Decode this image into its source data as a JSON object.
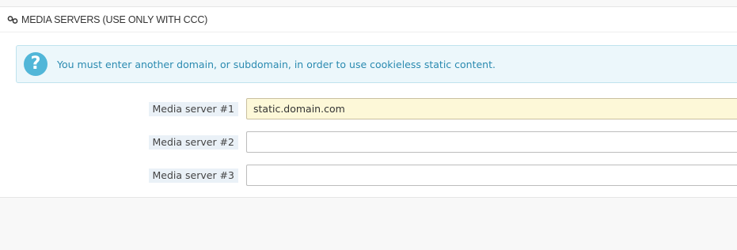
{
  "panel": {
    "title": "MEDIA SERVERS (USE ONLY WITH CCC)",
    "title_icon": "link-icon"
  },
  "alert": {
    "icon": "question-icon",
    "icon_glyph": "?",
    "message": "You must enter another domain, or subdomain, in order to use cookieless static content."
  },
  "fields": [
    {
      "label": "Media server #1",
      "value": "static.domain.com",
      "placeholder": ""
    },
    {
      "label": "Media server #2",
      "value": "",
      "placeholder": ""
    },
    {
      "label": "Media server #3",
      "value": "",
      "placeholder": ""
    }
  ],
  "colors": {
    "alert_bg": "#ecf7fb",
    "alert_text": "#2a8ab0",
    "icon_bg": "#51b6d8",
    "filled_field_bg": "#fdf8d8"
  }
}
